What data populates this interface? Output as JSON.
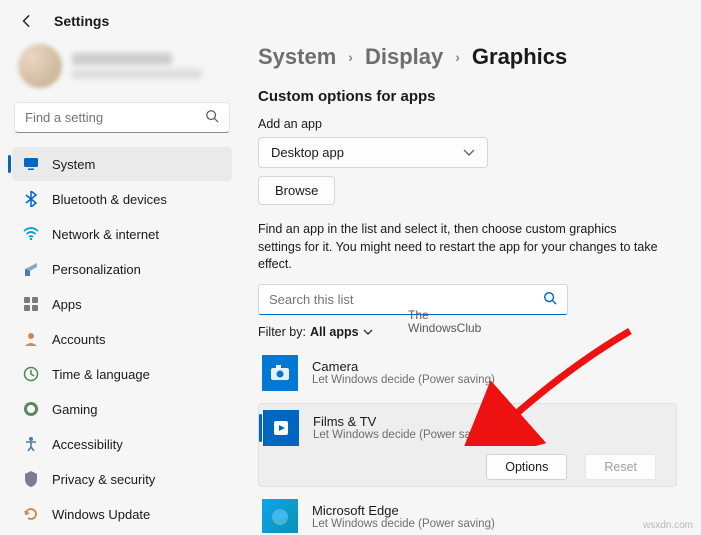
{
  "header": {
    "title": "Settings"
  },
  "search": {
    "placeholder": "Find a setting"
  },
  "sidebar": {
    "items": [
      {
        "label": "System"
      },
      {
        "label": "Bluetooth & devices"
      },
      {
        "label": "Network & internet"
      },
      {
        "label": "Personalization"
      },
      {
        "label": "Apps"
      },
      {
        "label": "Accounts"
      },
      {
        "label": "Time & language"
      },
      {
        "label": "Gaming"
      },
      {
        "label": "Accessibility"
      },
      {
        "label": "Privacy & security"
      },
      {
        "label": "Windows Update"
      }
    ]
  },
  "breadcrumb": {
    "a": "System",
    "b": "Display",
    "c": "Graphics"
  },
  "main": {
    "section_title": "Custom options for apps",
    "add_label": "Add an app",
    "dropdown_value": "Desktop app",
    "browse": "Browse",
    "help": "Find an app in the list and select it, then choose custom graphics settings for it. You might need to restart the app for your changes to take effect.",
    "list_search_placeholder": "Search this list",
    "filter_label": "Filter by:",
    "filter_value": "All apps",
    "watermark_a": "The",
    "watermark_b": "WindowsClub",
    "options_label": "Options",
    "reset_label": "Reset"
  },
  "apps": [
    {
      "name": "Camera",
      "sub": "Let Windows decide (Power saving)"
    },
    {
      "name": "Films & TV",
      "sub": "Let Windows decide (Power saving)"
    },
    {
      "name": "Microsoft Edge",
      "sub": "Let Windows decide (Power saving)"
    }
  ],
  "footer": {
    "mark": "wsxdn.com"
  }
}
